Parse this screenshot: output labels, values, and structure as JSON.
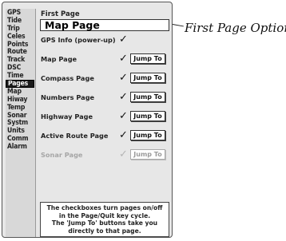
{
  "sidebar": {
    "items": [
      "GPS",
      "Tide",
      "Trip",
      "Celes",
      "Points",
      "Route",
      "Track",
      "DSC",
      "Time",
      "Pages",
      "Map",
      "Hiway",
      "Temp",
      "Sonar",
      "Systm",
      "Units",
      "Comm",
      "Alarm"
    ],
    "active": "Pages"
  },
  "first_page": {
    "label": "First Page",
    "value": "Map Page"
  },
  "rows": [
    {
      "label": "GPS Info (power-up)",
      "checked": true,
      "jump": ""
    },
    {
      "label": "Map Page",
      "checked": true,
      "jump": "Jump To"
    },
    {
      "label": "Compass Page",
      "checked": true,
      "jump": "Jump To"
    },
    {
      "label": "Numbers Page",
      "checked": true,
      "jump": "Jump To"
    },
    {
      "label": "Highway Page",
      "checked": true,
      "jump": "Jump To"
    },
    {
      "label": "Active Route Page",
      "checked": true,
      "jump": "Jump To"
    },
    {
      "label": "Sonar Page",
      "checked": true,
      "jump": "Jump To",
      "disabled": true
    }
  ],
  "help": {
    "line1": "The checkboxes turn pages on/off in the Page/Quit key cycle.",
    "line2": "The 'Jump To' buttons take you directly to that page."
  },
  "callout": "First Page Option",
  "check_glyph": "✓"
}
